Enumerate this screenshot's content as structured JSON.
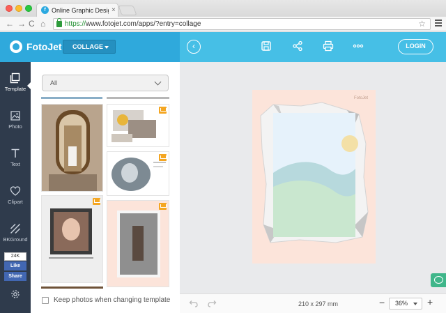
{
  "browser": {
    "tab_title": "Online Graphic Designer | ",
    "url_https": "https://",
    "url_rest": "www.fotojet.com/apps/?entry=collage"
  },
  "header": {
    "brand": "FotoJet",
    "mode_dropdown": "COLLAGE",
    "login_label": "LOGIN",
    "icons": [
      "back-icon",
      "save-icon",
      "share-icon",
      "print-icon",
      "more-icon"
    ]
  },
  "sidebar": {
    "items": [
      {
        "label": "Template",
        "icon": "template-icon",
        "active": true
      },
      {
        "label": "Photo",
        "icon": "photo-icon",
        "active": false
      },
      {
        "label": "Text",
        "icon": "text-icon",
        "active": false
      },
      {
        "label": "Clipart",
        "icon": "heart-icon",
        "active": false
      },
      {
        "label": "BKGround",
        "icon": "background-icon",
        "active": false
      }
    ],
    "facebook": {
      "count": "24K",
      "like": "Like",
      "share": "Share"
    },
    "settings_icon": "gear-icon"
  },
  "panel": {
    "filter_value": "All",
    "keep_photos_label": "Keep photos when changing template",
    "keep_photos_checked": false
  },
  "canvas": {
    "brand_watermark": "FotoJet"
  },
  "bottom": {
    "dimensions": "210 x 297 mm",
    "zoom": "36%",
    "zoom_minus": "−",
    "zoom_plus": "+"
  },
  "colors": {
    "header_left": "#2fa9dc",
    "header_right": "#46bfe6",
    "sidebar": "#2f3b4c",
    "artboard": "#fce4da",
    "premium_crown": "#f4a622"
  }
}
